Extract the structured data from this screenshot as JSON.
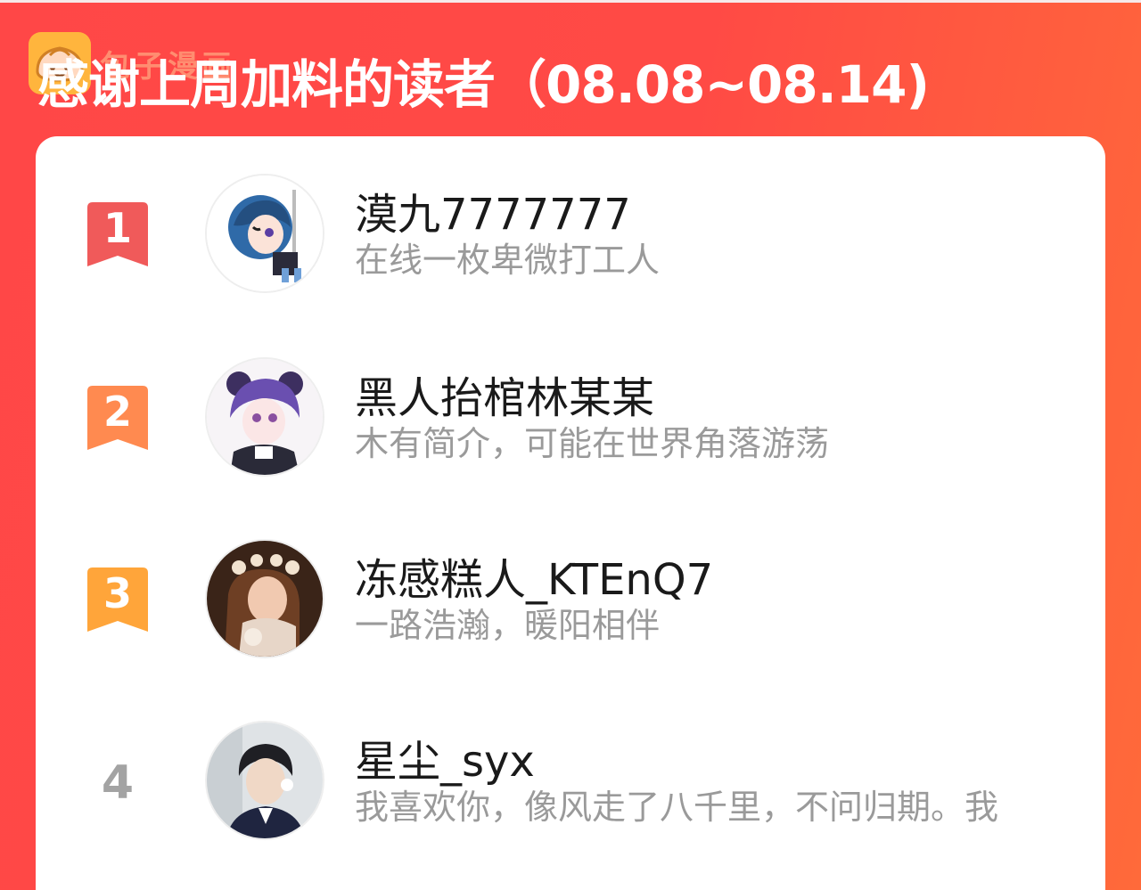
{
  "watermark": {
    "text": "包子漫画"
  },
  "header": {
    "title": "感谢上周加料的读者（08.08~08.14)"
  },
  "colors": {
    "background_start": "#ff4747",
    "background_end": "#ff6a3a",
    "rank1": "#f05a5a",
    "rank2": "#ff8a50",
    "rank3": "#ffa53a",
    "rank_plain": "#a3a3a3"
  },
  "leaderboard": [
    {
      "rank": "1",
      "badge": "ribbon-bookmark-icon",
      "avatar": "anime-girl-blue-hair-avatar",
      "name": "漠九7777777",
      "bio": "在线一枚卑微打工人"
    },
    {
      "rank": "2",
      "badge": "ribbon-bookmark-icon",
      "avatar": "anime-girl-purple-hair-avatar",
      "name": "黑人抬棺林某某",
      "bio": "木有简介，可能在世界角落游荡"
    },
    {
      "rank": "3",
      "badge": "ribbon-bookmark-icon",
      "avatar": "painted-girl-flower-crown-avatar",
      "name": "冻感糕人_KTEnQ7",
      "bio": "一路浩瀚，暖阳相伴"
    },
    {
      "rank": "4",
      "avatar": "boy-with-flower-avatar",
      "name": "星尘_syx",
      "bio": "我喜欢你，像风走了八千里，不问归期。我"
    }
  ]
}
